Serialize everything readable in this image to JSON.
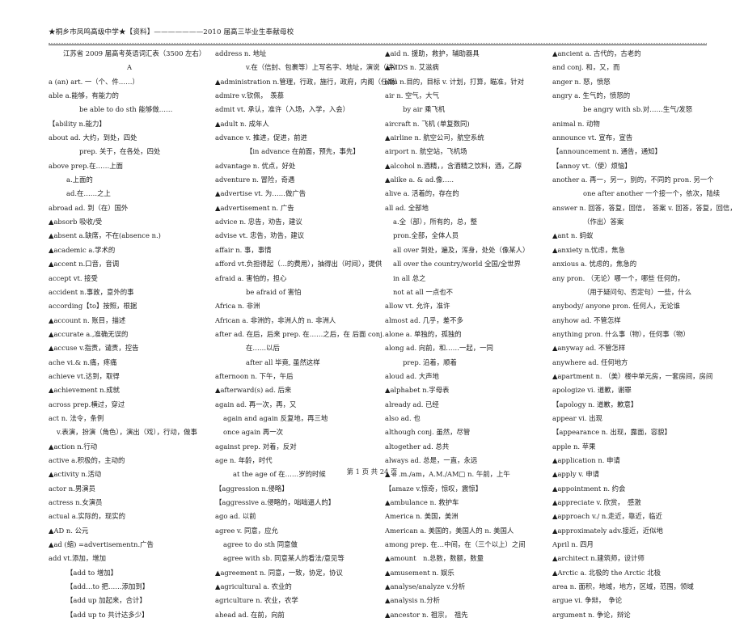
{
  "header": {
    "text": "★桐乡市凤鸣高级中学★【资料】———————2010 届高三毕业生奉献母校"
  },
  "columns": [
    {
      "lines": [
        {
          "text": "江苏省 2009 届高考英语词汇表（3500 左右）",
          "style": "title"
        },
        {
          "text": "A",
          "style": "center"
        },
        {
          "text": "a (an) art. 一（个、件……）",
          "style": ""
        },
        {
          "text": "able a.能够，有能力的",
          "style": ""
        },
        {
          "text": "be able to do sth 能够做……",
          "style": "ind3"
        },
        {
          "text": "【ability n.能力】",
          "style": ""
        },
        {
          "text": "about ad. 大约，到处，四处",
          "style": ""
        },
        {
          "text": "prep. 关于，在各处，四处",
          "style": "ind3"
        },
        {
          "text": "above prep.在……上面",
          "style": ""
        },
        {
          "text": "a.上面的",
          "style": "ind2"
        },
        {
          "text": "ad.在……之上",
          "style": "ind2"
        },
        {
          "text": "abroad ad. 到（在）国外",
          "style": ""
        },
        {
          "text": "▲absorb 吸收/受",
          "style": ""
        },
        {
          "text": "▲absent a.缺席，不在(absence n.)",
          "style": ""
        },
        {
          "text": "▲academic a.学术的",
          "style": ""
        },
        {
          "text": "▲accent n.口音，音调",
          "style": ""
        },
        {
          "text": "accept vt. 接受",
          "style": ""
        },
        {
          "text": "accident n.事故，意外的事",
          "style": ""
        },
        {
          "text": "according【to】按照，根据",
          "style": ""
        },
        {
          "text": "▲account n. 账目，描述",
          "style": ""
        },
        {
          "text": "▲accurate a.,准确无误的",
          "style": ""
        },
        {
          "text": "▲accuse v.指责，谴责，控告",
          "style": ""
        },
        {
          "text": "ache vi.& n.痛，疼痛",
          "style": ""
        },
        {
          "text": "achieve vt.达到，取得",
          "style": ""
        },
        {
          "text": "▲achievement n.成就",
          "style": ""
        },
        {
          "text": "across prep.横过，穿过",
          "style": ""
        },
        {
          "text": "act n. 法令，条例",
          "style": ""
        },
        {
          "text": "v.表演，扮演（角色），演出（戏），行动，做事",
          "style": "ind1"
        },
        {
          "text": "▲action n.行动",
          "style": ""
        },
        {
          "text": "active a.积极的，主动的",
          "style": ""
        },
        {
          "text": "▲activity n.活动",
          "style": ""
        },
        {
          "text": "actor n.男演员",
          "style": ""
        },
        {
          "text": "actress n.女演员",
          "style": ""
        },
        {
          "text": "actual a.实际的，现实的",
          "style": ""
        },
        {
          "text": "▲AD n. 公元",
          "style": ""
        },
        {
          "text": "▲ad (缩) =advertisementn.广告",
          "style": ""
        },
        {
          "text": "add vt.添加，增加",
          "style": ""
        },
        {
          "text": "【add to 增加】",
          "style": "ind2"
        },
        {
          "text": "【add…to 把……添加到】",
          "style": "ind2"
        },
        {
          "text": "【add up 加起来，合计】",
          "style": "ind2"
        },
        {
          "text": "【add up to 共计达多少】",
          "style": "ind2"
        }
      ]
    },
    {
      "lines": [
        {
          "text": "address n. 地址",
          "style": ""
        },
        {
          "text": "v.在（信封、包裹等）上写名字、地址，演说（讲）",
          "style": "ind3"
        },
        {
          "text": "▲administration n.管理，行政，施行，政府，内阁（任期）",
          "style": ""
        },
        {
          "text": "admire v.钦佩，　羡慕",
          "style": ""
        },
        {
          "text": "admit vt. 承认，准许（入场，入学，入会）",
          "style": ""
        },
        {
          "text": "▲adult n. 成年人",
          "style": ""
        },
        {
          "text": "advance v. 推进，促进，前进",
          "style": ""
        },
        {
          "text": "【in advance 在前面，预先，事先】",
          "style": "ind3"
        },
        {
          "text": "advantage n. 优点，好处",
          "style": ""
        },
        {
          "text": "adventure n. 冒险，奇遇",
          "style": ""
        },
        {
          "text": "▲advertise vt. 为……做广告",
          "style": ""
        },
        {
          "text": "▲advertisement n. 广告",
          "style": ""
        },
        {
          "text": "advice n. 忠告，劝告，建议",
          "style": ""
        },
        {
          "text": "advise vt. 忠告，劝告，建议",
          "style": ""
        },
        {
          "text": "affair n. 事，事情",
          "style": ""
        },
        {
          "text": "afford vt.负担得起（…的费用），抽得出（时间），提供",
          "style": ""
        },
        {
          "text": "afraid a. 害怕的，担心",
          "style": ""
        },
        {
          "text": "be afraid of 害怕",
          "style": "ind3"
        },
        {
          "text": "Africa n. 非洲",
          "style": ""
        },
        {
          "text": "African a. 非洲的，非洲人的 n. 非洲人",
          "style": ""
        },
        {
          "text": "after ad. 在后，后来 prep. 在……之后，在 后面 conj.",
          "style": ""
        },
        {
          "text": "在……以后",
          "style": "ind3"
        },
        {
          "text": "after all 毕竟, 虽然这样",
          "style": "ind3"
        },
        {
          "text": "afternoon n. 下午，午后",
          "style": ""
        },
        {
          "text": "▲afterward(s) ad. 后来",
          "style": ""
        },
        {
          "text": "again ad. 再一次，再，又",
          "style": ""
        },
        {
          "text": "again and again 反复地，再三地",
          "style": "ind1"
        },
        {
          "text": "once again 再一次",
          "style": "ind1"
        },
        {
          "text": "against prep. 对着，反对",
          "style": ""
        },
        {
          "text": "age n. 年龄，时代",
          "style": ""
        },
        {
          "text": "at the age of 在……岁的时候",
          "style": "ind2"
        },
        {
          "text": "【aggression n.侵略】",
          "style": ""
        },
        {
          "text": "【aggressive a.侵略的，咄咄逼人的】",
          "style": ""
        },
        {
          "text": "ago ad. 以前",
          "style": ""
        },
        {
          "text": "agree v. 同意，应允",
          "style": ""
        },
        {
          "text": "agree to do sth 同意做",
          "style": "ind1"
        },
        {
          "text": "agree with sb. 同意某人的看法/意见等",
          "style": "ind1"
        },
        {
          "text": "▲agreement n. 同意，一致，协定，协议",
          "style": ""
        },
        {
          "text": "▲agricultural a. 农业的",
          "style": ""
        },
        {
          "text": "agriculture n. 农业，农学",
          "style": ""
        },
        {
          "text": "ahead ad. 在前，向前",
          "style": ""
        }
      ]
    },
    {
      "lines": [
        {
          "text": "▲aid n. 援助，救护，辅助器具",
          "style": ""
        },
        {
          "text": "▲AIDS n. 艾滋病",
          "style": ""
        },
        {
          "text": "aim n.目的，目标 v. 计划，打算，瞄准，针对",
          "style": ""
        },
        {
          "text": "air n. 空气，大气",
          "style": ""
        },
        {
          "text": "by air 乘飞机",
          "style": "ind2"
        },
        {
          "text": "aircraft n. 飞机 (单复数同)",
          "style": ""
        },
        {
          "text": "▲airline n. 航空公司，航空系统",
          "style": ""
        },
        {
          "text": "airport n. 航空站，飞机场",
          "style": ""
        },
        {
          "text": "▲alcohol n.酒精，，含酒精之饮料，酒，乙醇",
          "style": ""
        },
        {
          "text": "▲alike a. & ad.像…..",
          "style": ""
        },
        {
          "text": "alive a. 活着的，存在的",
          "style": ""
        },
        {
          "text": "all ad. 全部地",
          "style": ""
        },
        {
          "text": "a.全（部），所有的，总，整",
          "style": "ind1"
        },
        {
          "text": "pron.全部，全体人员",
          "style": "ind1"
        },
        {
          "text": "all over 到处，遍及，浑身，处处（像某人）",
          "style": "ind1"
        },
        {
          "text": "all over the country/world 全国/全世界",
          "style": "ind1"
        },
        {
          "text": "in all 总之",
          "style": "ind1"
        },
        {
          "text": "not at all 一点也不",
          "style": "ind1"
        },
        {
          "text": "allow vt. 允许，准许",
          "style": ""
        },
        {
          "text": "almost ad. 几乎，差不多",
          "style": ""
        },
        {
          "text": "alone a. 单独的，孤独的",
          "style": ""
        },
        {
          "text": "along ad. 向前，和……一起，一同",
          "style": ""
        },
        {
          "text": "prep. 沿着，顺着",
          "style": "ind2"
        },
        {
          "text": "aloud ad. 大声地",
          "style": ""
        },
        {
          "text": "▲alphabet n.字母表",
          "style": ""
        },
        {
          "text": "already ad. 已经",
          "style": ""
        },
        {
          "text": "also ad. 也",
          "style": ""
        },
        {
          "text": "although conj. 虽然，尽管",
          "style": ""
        },
        {
          "text": "altogether ad. 总共",
          "style": ""
        },
        {
          "text": "always ad. 总是，一直，永远",
          "style": ""
        },
        {
          "text": "▲ a .m./am，A.M./AM□ n. 午前，上午",
          "style": ""
        },
        {
          "text": "【amaze v.惊奇，惊叹，震惊】",
          "style": ""
        },
        {
          "text": "▲ambulance n. 救护车",
          "style": ""
        },
        {
          "text": "America n. 美国，美洲",
          "style": ""
        },
        {
          "text": "American a. 美国的，美国人的 n. 美国人",
          "style": ""
        },
        {
          "text": "among prep. 在…中间，在（三个以上）之间",
          "style": ""
        },
        {
          "text": "▲amount　n.总数，数额，数量",
          "style": ""
        },
        {
          "text": "▲amusement n. 娱乐",
          "style": ""
        },
        {
          "text": "▲analyse/analyze v.分析",
          "style": ""
        },
        {
          "text": "▲analysis n.分析",
          "style": ""
        },
        {
          "text": "▲ancestor n. 祖宗，　祖先",
          "style": ""
        }
      ]
    },
    {
      "lines": [
        {
          "text": "▲ancient a. 古代的，古老的",
          "style": ""
        },
        {
          "text": "and conj. 和，又，而",
          "style": ""
        },
        {
          "text": "anger n. 怒，愤怒",
          "style": ""
        },
        {
          "text": "angry a. 生气的，愤怒的",
          "style": ""
        },
        {
          "text": "be angry with sb.对……生气/发怒",
          "style": "ind3"
        },
        {
          "text": "animal n. 动物",
          "style": ""
        },
        {
          "text": "announce vt. 宣布，宣告",
          "style": ""
        },
        {
          "text": "【announcement n. 通告，通知】",
          "style": ""
        },
        {
          "text": "【annoy vt.（使）烦恼】",
          "style": ""
        },
        {
          "text": "another a. 再一，另一，别的，不同的 pron. 另一个",
          "style": ""
        },
        {
          "text": "one after another 一个接一个，依次，陆续",
          "style": "ind3"
        },
        {
          "text": "answer n. 回答，答复，回信，　答案 v. 回答，答复，回信，",
          "style": ""
        },
        {
          "text": "（作出）答案",
          "style": "ind3"
        },
        {
          "text": "▲ant n. 蚂蚁",
          "style": ""
        },
        {
          "text": "▲anxiety n.忧虑，焦急",
          "style": ""
        },
        {
          "text": "anxious a. 忧虑的，焦急的",
          "style": ""
        },
        {
          "text": "any pron. （无论）哪一个，哪些 任何的，",
          "style": ""
        },
        {
          "text": "（用于疑问句、否定句）一些，什么",
          "style": "ind3"
        },
        {
          "text": "anybody/ anyone pron. 任何人，无论谁",
          "style": ""
        },
        {
          "text": "anyhow ad. 不管怎样",
          "style": ""
        },
        {
          "text": "anything pron. 什么事（物），任何事（物）",
          "style": ""
        },
        {
          "text": "▲anyway ad. 不管怎样",
          "style": ""
        },
        {
          "text": "anywhere ad. 任何地方",
          "style": ""
        },
        {
          "text": "▲apartment n. （美）楼中单元房，一套房间，房间",
          "style": ""
        },
        {
          "text": "apologize vi. 道歉，谢罪",
          "style": ""
        },
        {
          "text": "【apology n. 道歉，歉意】",
          "style": ""
        },
        {
          "text": "appear vi. 出现",
          "style": ""
        },
        {
          "text": "【appearance n. 出现，露面，容貌】",
          "style": ""
        },
        {
          "text": "apple n. 苹果",
          "style": ""
        },
        {
          "text": "▲application n. 申请",
          "style": ""
        },
        {
          "text": "▲apply v. 申请",
          "style": ""
        },
        {
          "text": "▲appointment n. 约会",
          "style": ""
        },
        {
          "text": "▲appreciate v. 欣赏，　感激",
          "style": ""
        },
        {
          "text": "▲approach v./ n.走近，靠近，临近",
          "style": ""
        },
        {
          "text": "▲approximately adv.接近，近似地",
          "style": ""
        },
        {
          "text": "April n. 四月",
          "style": ""
        },
        {
          "text": "▲architect n.建筑师，设计师",
          "style": ""
        },
        {
          "text": "▲Arctic a. 北极的 the Arctic 北极",
          "style": ""
        },
        {
          "text": "area n. 面积，地域，地方，区域，范围，领域",
          "style": ""
        },
        {
          "text": "argue vi. 争辩，　争论",
          "style": ""
        },
        {
          "text": "argument n. 争论，辩论",
          "style": ""
        }
      ]
    }
  ],
  "footer": {
    "text": "第 1 页 共 24 页"
  }
}
